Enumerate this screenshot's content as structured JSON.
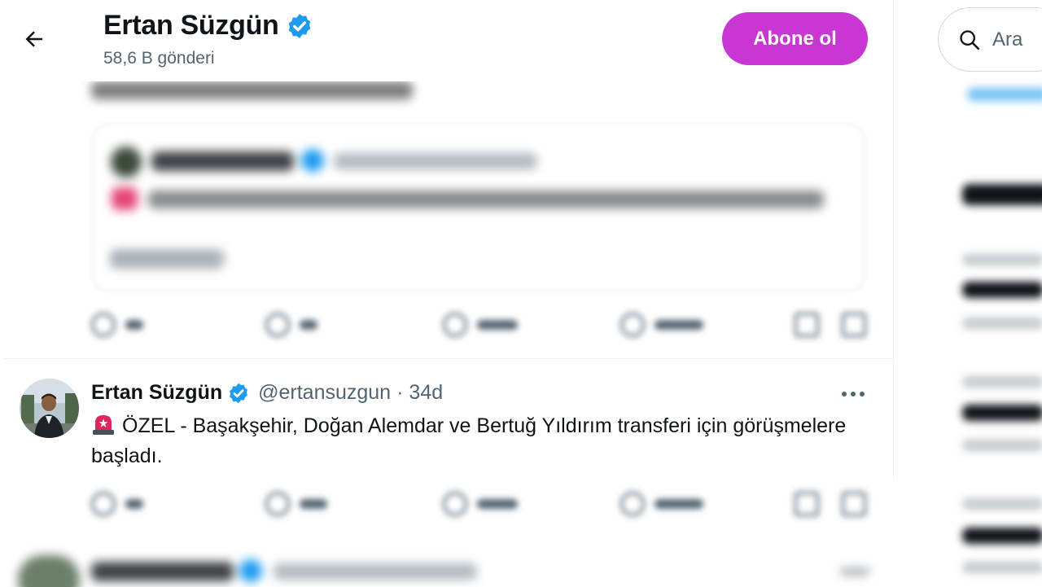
{
  "header": {
    "title": "Ertan Süzgün",
    "post_count": "58,6 B gönderi",
    "subscribe_label": "Abone ol"
  },
  "search": {
    "placeholder": "Ara"
  },
  "tweet": {
    "author_name": "Ertan Süzgün",
    "handle": "@ertansuzgun",
    "separator": "·",
    "time": "34d",
    "text": "ÖZEL - Başakşehir, Doğan Alemdar ve Bertuğ Yıldırım transferi için görüşmelere başladı."
  },
  "icons": {
    "back": "arrow-left-icon",
    "verified": "verified-badge-icon",
    "search": "search-icon",
    "more": "more-horizontal-icon",
    "siren": "rotating-light-icon",
    "reply": "reply-icon",
    "retweet": "retweet-icon",
    "like": "heart-icon",
    "views": "views-icon",
    "bookmark": "bookmark-icon",
    "share": "share-icon"
  },
  "colors": {
    "subscribe_button": "#c936d4",
    "verified_badge": "#1d9bf0",
    "secondary_text": "#536471",
    "primary_text": "#0f1419"
  }
}
